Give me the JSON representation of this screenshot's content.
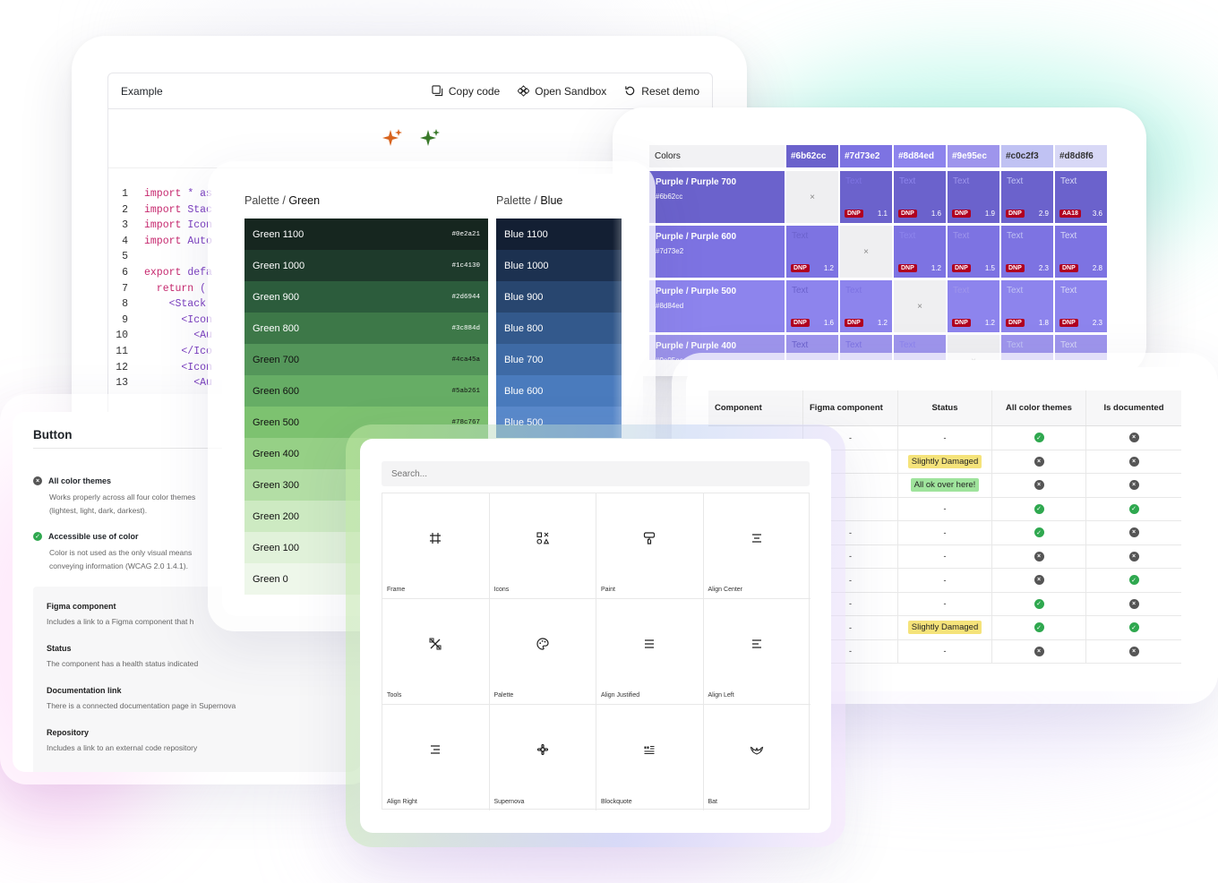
{
  "code_example": {
    "title": "Example",
    "copy_label": "Copy code",
    "sandbox_label": "Open Sandbox",
    "reset_label": "Reset demo",
    "lines": [
      {
        "n": "1",
        "kw": "import",
        "rest": " * as"
      },
      {
        "n": "2",
        "kw": "import",
        "rest": " Stac"
      },
      {
        "n": "3",
        "kw": "import",
        "rest": " Icon"
      },
      {
        "n": "4",
        "kw": "import",
        "rest": " Auto"
      },
      {
        "n": "5",
        "kw": "",
        "rest": ""
      },
      {
        "n": "6",
        "kw": "export",
        "rest": " defa"
      },
      {
        "n": "7",
        "kw": "  return",
        "rest": " ("
      },
      {
        "n": "8",
        "kw": "",
        "rest": "    <Stack"
      },
      {
        "n": "9",
        "kw": "",
        "rest": "      <Icon"
      },
      {
        "n": "10",
        "kw": "",
        "rest": "        <Au"
      },
      {
        "n": "11",
        "kw": "",
        "rest": "      </Ico"
      },
      {
        "n": "12",
        "kw": "",
        "rest": "      <Icon"
      },
      {
        "n": "13",
        "kw": "",
        "rest": "        <Au"
      }
    ],
    "sparkle_colors": [
      "#d9651f",
      "#3a7a2a"
    ]
  },
  "button_card": {
    "title": "Button",
    "requirements": [
      {
        "status": "fail",
        "title": "All color themes",
        "desc_1": "Works properly across all four color themes",
        "desc_2": "(lightest, light, dark, darkest)."
      },
      {
        "status": "pass",
        "title": "Accessible use of color",
        "desc_1": "Color is not used as the only visual means",
        "desc_2": "conveying information (WCAG 2.0 1.4.1)."
      }
    ],
    "items": [
      {
        "title": "Figma component",
        "desc": "Includes a link to a Figma component that h"
      },
      {
        "title": "Status",
        "desc": "The component has a health status indicated"
      },
      {
        "title": "Documentation link",
        "desc": "There is a connected documentation page in Supernova"
      },
      {
        "title": "Repository",
        "desc": "Includes a link to an external code repository"
      }
    ]
  },
  "palettes": {
    "green_prefix": "Palette / ",
    "green_name": "Green",
    "blue_prefix": "Palette / ",
    "blue_name": "Blue",
    "green": [
      {
        "name": "Green 1100",
        "hex": "#0e2a21",
        "bg": "#16261f",
        "fg": "#ffffff"
      },
      {
        "name": "Green 1000",
        "hex": "#1c4130",
        "bg": "#1e3a2b",
        "fg": "#ffffff"
      },
      {
        "name": "Green 900",
        "hex": "#2d6944",
        "bg": "#2c5c3c",
        "fg": "#ffffff"
      },
      {
        "name": "Green 800",
        "hex": "#3c884d",
        "bg": "#3d7848",
        "fg": "#ffffff"
      },
      {
        "name": "Green 700",
        "hex": "#4ca45a",
        "bg": "#54965a",
        "fg": "#111111"
      },
      {
        "name": "Green 600",
        "hex": "#5ab261",
        "bg": "#66ad65",
        "fg": "#111111"
      },
      {
        "name": "Green 500",
        "hex": "#78c767",
        "bg": "#7dc270",
        "fg": "#111111"
      },
      {
        "name": "Green 400",
        "hex": "",
        "bg": "#96d086",
        "fg": "#111111"
      },
      {
        "name": "Green 300",
        "hex": "",
        "bg": "#b3dea5",
        "fg": "#111111"
      },
      {
        "name": "Green 200",
        "hex": "",
        "bg": "#cdeac2",
        "fg": "#111111"
      },
      {
        "name": "Green 100",
        "hex": "",
        "bg": "#e1f2da",
        "fg": "#111111"
      },
      {
        "name": "Green 0",
        "hex": "",
        "bg": "#eef7ea",
        "fg": "#111111"
      }
    ],
    "blue": [
      {
        "name": "Blue 1100",
        "bg": "#131f33"
      },
      {
        "name": "Blue 1000",
        "bg": "#1c3150"
      },
      {
        "name": "Blue 900",
        "bg": "#28466f"
      },
      {
        "name": "Blue 800",
        "bg": "#33598c"
      },
      {
        "name": "Blue 700",
        "bg": "#3e6aa5"
      },
      {
        "name": "Blue 600",
        "bg": "#4a7bbd"
      },
      {
        "name": "Blue 500",
        "bg": "#5a8acb"
      }
    ]
  },
  "colors_table": {
    "corner": "Colors",
    "headers": [
      "#6b62cc",
      "#7d73e2",
      "#8d84ed",
      "#9e95ec",
      "#c0c2f3",
      "#d8d8f6"
    ],
    "header_colors": [
      "#6b62cc",
      "#7d73e2",
      "#8d84ed",
      "#9e95ec",
      "#c0c2f3",
      "#d8d8f6"
    ],
    "cell_text": "Text",
    "rows": [
      {
        "name": "Purple / Purple 700",
        "hex": "#6b62cc",
        "bg": "#6b62cc",
        "cells": [
          {
            "x": true
          },
          {
            "badge": "DNP",
            "ratio": "1.1"
          },
          {
            "badge": "DNP",
            "ratio": "1.6"
          },
          {
            "badge": "DNP",
            "ratio": "1.9"
          },
          {
            "badge": "DNP",
            "ratio": "2.9"
          },
          {
            "badge": "AA18",
            "ratio": "3.6"
          }
        ]
      },
      {
        "name": "Purple / Purple 600",
        "hex": "#7d73e2",
        "bg": "#7d73e2",
        "cells": [
          {
            "badge": "DNP",
            "ratio": "1.2"
          },
          {
            "x": true
          },
          {
            "badge": "DNP",
            "ratio": "1.2"
          },
          {
            "badge": "DNP",
            "ratio": "1.5"
          },
          {
            "badge": "DNP",
            "ratio": "2.3"
          },
          {
            "badge": "DNP",
            "ratio": "2.8"
          }
        ]
      },
      {
        "name": "Purple / Purple 500",
        "hex": "#8d84ed",
        "bg": "#8d84ed",
        "cells": [
          {
            "badge": "DNP",
            "ratio": "1.6"
          },
          {
            "badge": "DNP",
            "ratio": "1.2"
          },
          {
            "x": true
          },
          {
            "badge": "DNP",
            "ratio": "1.2"
          },
          {
            "badge": "DNP",
            "ratio": "1.8"
          },
          {
            "badge": "DNP",
            "ratio": "2.3"
          }
        ]
      },
      {
        "name": "Purple / Purple 400",
        "hex": "#9e95ec",
        "bg": "#9e95ec",
        "cells": [
          {},
          {},
          {},
          {
            "x": true
          },
          {},
          {}
        ]
      }
    ],
    "partial_row": {
      "name": "Purp",
      "hex": "#c0c"
    }
  },
  "components_table": {
    "headers": [
      "Component",
      "Figma component",
      "Status",
      "All color themes",
      "Is documented"
    ],
    "rows": [
      {
        "figma": "-",
        "status": "-",
        "status_color": "",
        "themes": "ok",
        "doc": "no"
      },
      {
        "figma": "",
        "status": "Slightly Damaged",
        "status_color": "#f5e37a",
        "themes": "no",
        "doc": "no"
      },
      {
        "figma": "",
        "status": "All ok over here!",
        "status_color": "#9fe39c",
        "themes": "no",
        "doc": "no"
      },
      {
        "figma": "",
        "status": "-",
        "status_color": "",
        "themes": "ok",
        "doc": "ok"
      },
      {
        "figma": "-",
        "status": "-",
        "status_color": "",
        "themes": "ok",
        "doc": "no"
      },
      {
        "figma": "-",
        "status": "-",
        "status_color": "",
        "themes": "no",
        "doc": "no"
      },
      {
        "figma": "-",
        "status": "-",
        "status_color": "",
        "themes": "no",
        "doc": "ok"
      },
      {
        "figma": "-",
        "status": "-",
        "status_color": "",
        "themes": "ok",
        "doc": "no"
      },
      {
        "figma": "-",
        "status": "Slightly Damaged",
        "status_color": "#f5e37a",
        "themes": "ok",
        "doc": "ok"
      },
      {
        "figma": "-",
        "status": "-",
        "status_color": "",
        "themes": "no",
        "doc": "no"
      }
    ]
  },
  "icons": {
    "search_placeholder": "Search...",
    "items": [
      {
        "label": "Frame",
        "icon": "frame-icon"
      },
      {
        "label": "Icons",
        "icon": "icons-icon"
      },
      {
        "label": "Paint",
        "icon": "paint-icon"
      },
      {
        "label": "Align Center",
        "icon": "align-center-icon"
      },
      {
        "label": "Tools",
        "icon": "tools-icon"
      },
      {
        "label": "Palette",
        "icon": "palette-icon"
      },
      {
        "label": "Align Justified",
        "icon": "align-justified-icon"
      },
      {
        "label": "Align Left",
        "icon": "align-left-icon"
      },
      {
        "label": "Align Right",
        "icon": "align-right-icon"
      },
      {
        "label": "Supernova",
        "icon": "supernova-icon"
      },
      {
        "label": "Blockquote",
        "icon": "blockquote-icon"
      },
      {
        "label": "Bat",
        "icon": "bat-icon"
      }
    ]
  }
}
